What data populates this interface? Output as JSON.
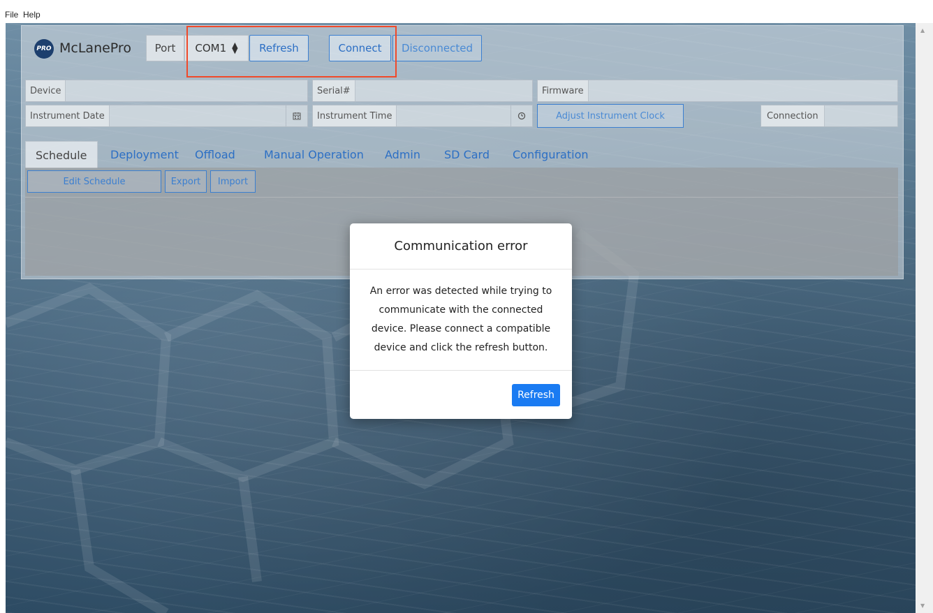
{
  "menu": {
    "file": "File",
    "help": "Help"
  },
  "app": {
    "logo_badge": "PRO",
    "title": "McLanePro"
  },
  "toolbar": {
    "port_label": "Port",
    "port_value": "COM1",
    "select_icon": "updown-caret-icon",
    "refresh_label": "Refresh",
    "connect_label": "Connect",
    "status_label": "Disconnected"
  },
  "fields": {
    "device_label": "Device",
    "serial_label": "Serial#",
    "firmware_label": "Firmware",
    "instrument_date_label": "Instrument Date",
    "instrument_time_label": "Instrument Time",
    "adjust_clock_label": "Adjust Instrument Clock",
    "connection_label": "Connection",
    "calendar_icon": "calendar-icon",
    "clock_icon": "clock-icon"
  },
  "tabs": [
    {
      "label": "Schedule",
      "active": true
    },
    {
      "label": "Deployment"
    },
    {
      "label": "Offload"
    },
    {
      "label": "Manual Operation"
    },
    {
      "label": "Admin"
    },
    {
      "label": "SD Card"
    },
    {
      "label": "Configuration"
    }
  ],
  "schedule": {
    "edit_label": "Edit Schedule",
    "export_label": "Export",
    "import_label": "Import"
  },
  "modal": {
    "title": "Communication error",
    "body": "An error was detected while trying to communicate with the connected device. Please connect a compatible device and click the refresh button.",
    "button_label": "Refresh"
  },
  "colors": {
    "accent": "#1a7bf2",
    "link": "#2c6fc4",
    "highlight": "#f0492a"
  }
}
